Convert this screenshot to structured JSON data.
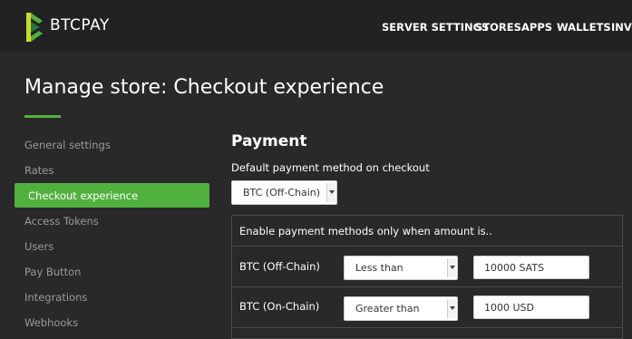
{
  "brand": {
    "name": "BTCPAY",
    "accent": "#51b13e"
  },
  "nav": {
    "items": [
      "SERVER SETTINGS",
      "STORES",
      "APPS",
      "WALLETS",
      "INVO"
    ]
  },
  "page": {
    "title": "Manage store: Checkout experience"
  },
  "sidebar": {
    "items": [
      {
        "label": "General settings",
        "active": false
      },
      {
        "label": "Rates",
        "active": false
      },
      {
        "label": "Checkout experience",
        "active": true
      },
      {
        "label": "Access Tokens",
        "active": false
      },
      {
        "label": "Users",
        "active": false
      },
      {
        "label": "Pay Button",
        "active": false
      },
      {
        "label": "Integrations",
        "active": false
      },
      {
        "label": "Webhooks",
        "active": false
      }
    ]
  },
  "payment": {
    "section_title": "Payment",
    "default_method_label": "Default payment method on checkout",
    "default_method_value": "BTC (Off-Chain)",
    "table_header": "Enable payment methods only when amount is..",
    "rows": [
      {
        "method": "BTC (Off-Chain)",
        "condition": "Less than",
        "amount": "10000 SATS"
      },
      {
        "method": "BTC (On-Chain)",
        "condition": "Greater than",
        "amount": "1000 USD"
      }
    ]
  }
}
